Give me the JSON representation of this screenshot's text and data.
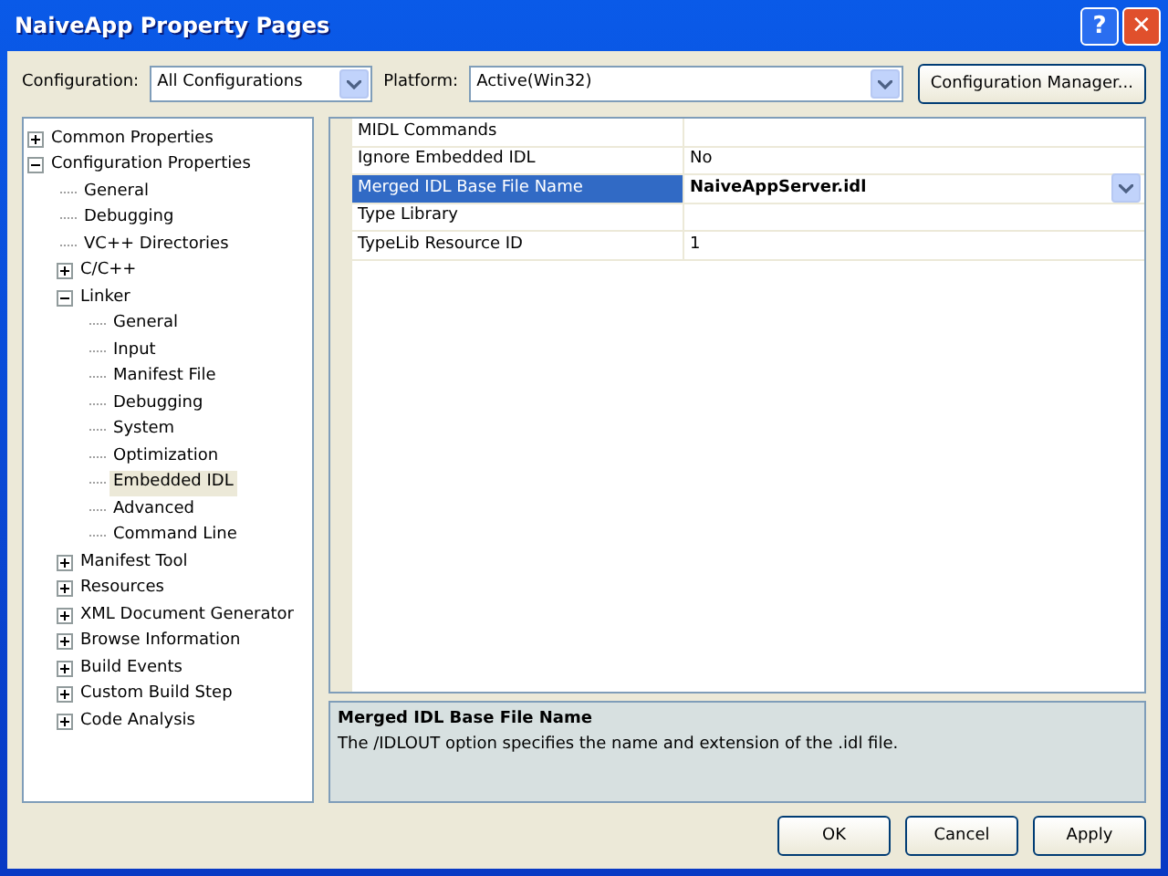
{
  "window": {
    "title": "NaiveApp Property Pages",
    "buttons": [
      "?",
      "✕"
    ]
  },
  "toolbar": {
    "configuration": {
      "label": "Configuration:",
      "value": "All Configurations"
    },
    "platform": {
      "label": "Platform:",
      "value": "Active(Win32)"
    },
    "manager_button": "Configuration Manager..."
  },
  "tree": [
    {
      "label": "Common Properties",
      "expanded": false,
      "selected": false
    },
    {
      "label": "Configuration Properties",
      "expanded": true,
      "selected": false,
      "children": [
        {
          "label": "General",
          "selected": false
        },
        {
          "label": "Debugging",
          "selected": false
        },
        {
          "label": "VC++ Directories",
          "selected": false
        },
        {
          "label": "C/C++",
          "expanded": false,
          "selected": false
        },
        {
          "label": "Linker",
          "expanded": true,
          "selected": false,
          "children": [
            {
              "label": "General",
              "selected": false
            },
            {
              "label": "Input",
              "selected": false
            },
            {
              "label": "Manifest File",
              "selected": false
            },
            {
              "label": "Debugging",
              "selected": false
            },
            {
              "label": "System",
              "selected": false
            },
            {
              "label": "Optimization",
              "selected": false
            },
            {
              "label": "Embedded IDL",
              "selected": true
            },
            {
              "label": "Advanced",
              "selected": false
            },
            {
              "label": "Command Line",
              "selected": false
            }
          ]
        },
        {
          "label": "Manifest Tool",
          "expanded": false,
          "selected": false
        },
        {
          "label": "Resources",
          "expanded": false,
          "selected": false
        },
        {
          "label": "XML Document Generator",
          "expanded": false,
          "selected": false
        },
        {
          "label": "Browse Information",
          "expanded": false,
          "selected": false
        },
        {
          "label": "Build Events",
          "expanded": false,
          "selected": false
        },
        {
          "label": "Custom Build Step",
          "expanded": false,
          "selected": false
        },
        {
          "label": "Code Analysis",
          "expanded": false,
          "selected": false
        }
      ]
    }
  ],
  "properties": [
    {
      "name": "MIDL Commands",
      "selected": false
    },
    {
      "name": "Ignore Embedded IDL",
      "value": "No",
      "selected": false,
      "modified": false
    },
    {
      "name": "Merged IDL Base File Name",
      "value": "NaiveAppServer.idl",
      "selected": true,
      "modified": true
    },
    {
      "name": "Type Library",
      "selected": false
    },
    {
      "name": "TypeLib Resource ID",
      "value": "1",
      "selected": false,
      "modified": false
    }
  ],
  "description": {
    "title": "Merged IDL Base File Name",
    "text": "The /IDLOUT option specifies the name and extension of the .idl file."
  },
  "buttons": [
    "OK",
    "Cancel",
    "Apply"
  ]
}
